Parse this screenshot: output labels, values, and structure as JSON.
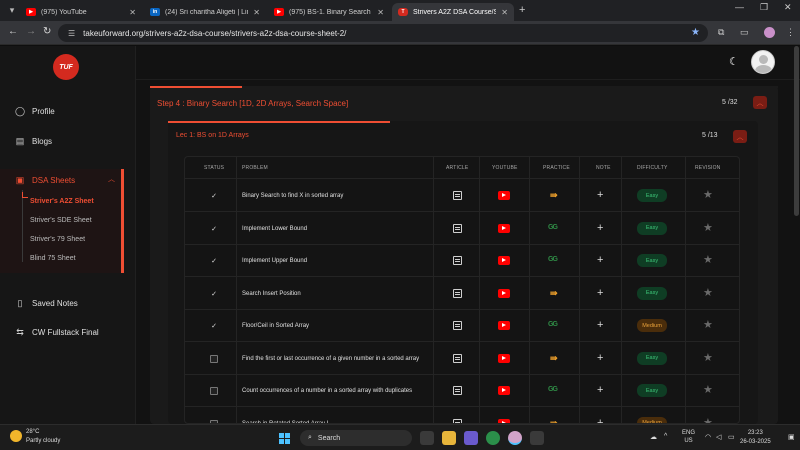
{
  "browser": {
    "tabs": [
      {
        "label": "(975) YouTube",
        "icon": "youtube-icon"
      },
      {
        "label": "(24) Sri charitha Aligeti | Linked",
        "icon": "linkedin-icon"
      },
      {
        "label": "(975) BS-1. Binary Search Introd",
        "icon": "youtube-icon"
      },
      {
        "label": "Strivers A2Z DSA Course/Sheet",
        "icon": "tuf-icon",
        "active": true
      }
    ],
    "url": "takeuforward.org/strivers-a2z-dsa-course/strivers-a2z-dsa-course-sheet-2/"
  },
  "sidebar": {
    "logo_text": "TUF",
    "profile": "Profile",
    "blogs": "Blogs",
    "dsa_sheets": "DSA Sheets",
    "sheets": [
      "Striver's A2Z Sheet",
      "Striver's SDE Sheet",
      "Striver's 79 Sheet",
      "Blind 75 Sheet"
    ],
    "saved_notes": "Saved Notes",
    "cw_fullstack": "CW Fullstack Final"
  },
  "step": {
    "title": "Step 4 : Binary Search [1D, 2D Arrays, Search Space]",
    "count": "5 /32"
  },
  "lecture": {
    "title": "Lec 1: BS on 1D Arrays",
    "count": "5 /13"
  },
  "table": {
    "headers": {
      "status": "STATUS",
      "problem": "PROBLEM",
      "article": "ARTICLE",
      "youtube": "YOUTUBE",
      "practice": "PRACTICE",
      "note": "NOTE",
      "difficulty": "DIFFICULTY",
      "revision": "REVISION"
    },
    "rows": [
      {
        "done": true,
        "problem": "Binary Search to find X in sorted array",
        "practice": "codingninjas",
        "difficulty": "Easy"
      },
      {
        "done": true,
        "problem": "Implement Lower Bound",
        "practice": "gfg",
        "difficulty": "Easy"
      },
      {
        "done": true,
        "problem": "Implement Upper Bound",
        "practice": "gfg",
        "difficulty": "Easy"
      },
      {
        "done": true,
        "problem": "Search Insert Position",
        "practice": "codingninjas",
        "difficulty": "Easy"
      },
      {
        "done": true,
        "problem": "Floor/Ceil in Sorted Array",
        "practice": "gfg",
        "difficulty": "Medium"
      },
      {
        "done": false,
        "problem": "Find the first or last occurrence of a given number in a sorted array",
        "practice": "codingninjas",
        "difficulty": "Easy"
      },
      {
        "done": false,
        "problem": "Count occurrences of a number in a sorted array with duplicates",
        "practice": "gfg",
        "difficulty": "Easy"
      },
      {
        "done": false,
        "problem": "Search in Rotated Sorted Array I",
        "practice": "codingninjas",
        "difficulty": "Medium"
      }
    ]
  },
  "taskbar": {
    "temp": "28°C",
    "weather": "Partly cloudy",
    "search": "Search",
    "lang1": "ENG",
    "lang2": "US",
    "time": "23:23",
    "date": "26-03-2025"
  },
  "colors": {
    "accent": "#ef4e33",
    "easy": "#3ec77a",
    "medium": "#e9a23b"
  }
}
